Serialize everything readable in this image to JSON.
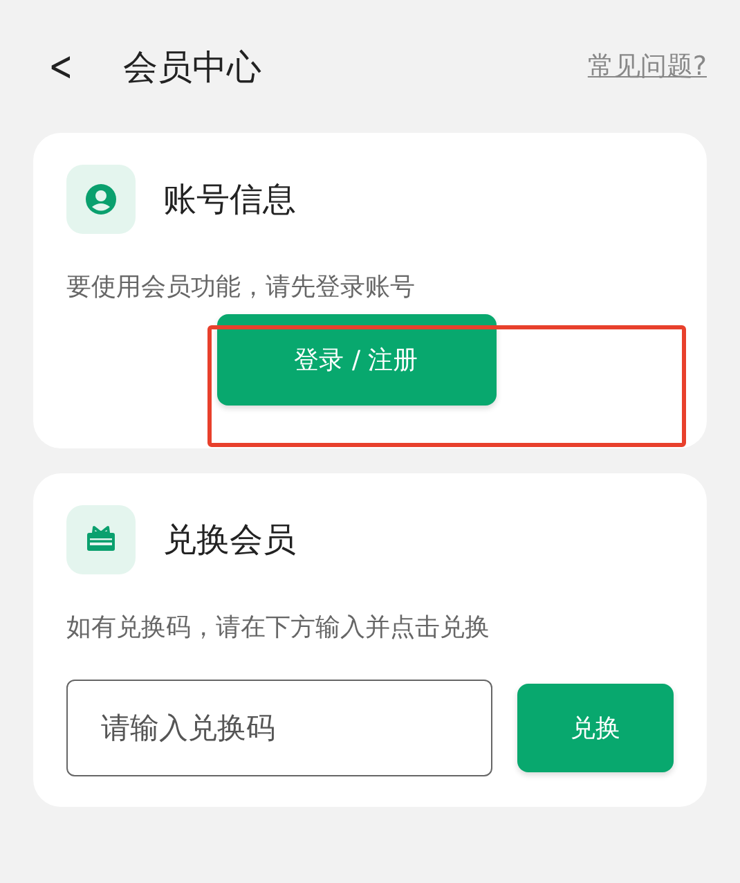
{
  "header": {
    "back": "<",
    "title": "会员中心",
    "help_link": "常见问题?"
  },
  "account_card": {
    "title": "账号信息",
    "description": "要使用会员功能，请先登录账号",
    "button": "登录 / 注册"
  },
  "redeem_card": {
    "title": "兑换会员",
    "description": "如有兑换码，请在下方输入并点击兑换",
    "input": {
      "placeholder": "请输入兑换码"
    },
    "button": "兑换"
  }
}
